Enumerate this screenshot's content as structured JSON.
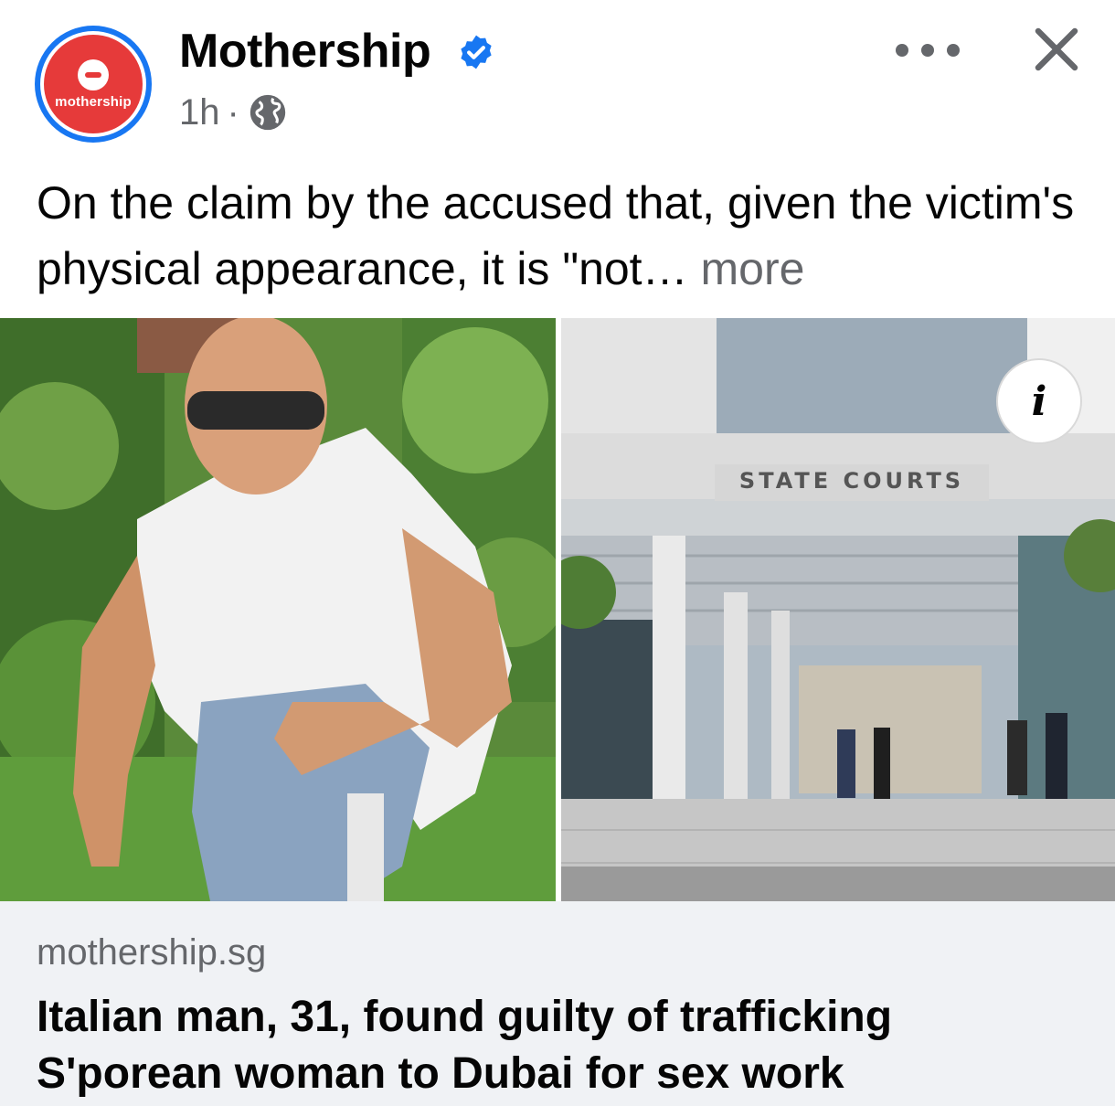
{
  "header": {
    "page_name": "Mothership",
    "avatar_text": "mothership",
    "time": "1h",
    "separator": "·",
    "verified_icon": "verified-badge-icon",
    "privacy_icon": "globe-icon"
  },
  "caption": {
    "text": "On the claim by the accused that, given the victim's physical appearance, it is \"not…",
    "see_more": "more"
  },
  "images": {
    "left_description_icon": "photo",
    "right_sign": "STATE COURTS",
    "info_label": "i"
  },
  "link": {
    "domain": "mothership.sg",
    "title": "Italian man, 31, found guilty of trafficking S'porean woman to Dubai for sex work"
  },
  "colors": {
    "brand_blue": "#1877f2",
    "mothership_red": "#e63a3a",
    "secondary_text": "#65676b",
    "primary_text": "#050505",
    "link_bg": "#f0f2f5"
  }
}
